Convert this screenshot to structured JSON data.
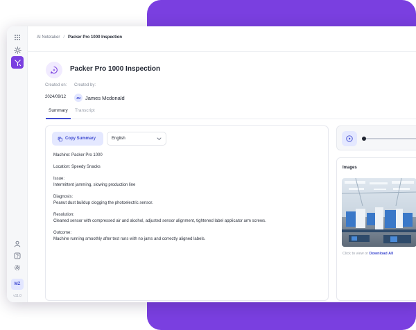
{
  "breadcrumb": {
    "root": "AI Notetaker",
    "separator": "/",
    "current": "Packer Pro 1000 Inspection"
  },
  "page": {
    "title": "Packer Pro 1000 Inspection",
    "title_icon": "sparkle-chat-icon"
  },
  "meta": {
    "created_on_label": "Created on:",
    "created_by_label": "Created by:",
    "created_on": "2024/09/12",
    "creator_initials": "JM",
    "creator_name": "James Mcdonald"
  },
  "tabs": [
    {
      "label": "Summary",
      "active": true
    },
    {
      "label": "Transcript",
      "active": false
    }
  ],
  "toolbar": {
    "copy_label": "Copy Summary",
    "language": "English"
  },
  "summary": {
    "machine": "Machine: Packer Pro 1000",
    "location": "Location: Speedy Snacks",
    "issue_label": "Issue:",
    "issue": "Intermittent jamming, slowing production line",
    "diagnosis_label": "Diagnosis:",
    "diagnosis": "Peanut dust buildup clogging the photoelectric sensor.",
    "resolution_label": "Resolution:",
    "resolution": "Cleaned sensor with compressed air and alcohol, adjusted sensor alignment, tightened label applicator arm screws.",
    "outcome_label": "Outcome:",
    "outcome": "Machine running smoothly after test runs with no jams and correctly aligned labels."
  },
  "player": {
    "progress_fraction": 0.02
  },
  "images": {
    "title": "Images",
    "caption_prefix": "Click to view or",
    "download_label": "Download All"
  },
  "sidebar": {
    "items": [
      {
        "icon": "grid-icon",
        "active": false
      },
      {
        "icon": "settings-icon",
        "active": false
      },
      {
        "icon": "workflow-icon",
        "active": true
      }
    ],
    "bottom_items": [
      {
        "icon": "user-icon"
      },
      {
        "icon": "help-icon"
      },
      {
        "icon": "gear-icon"
      }
    ],
    "user_initials": "MZ",
    "version": "v11.0"
  },
  "colors": {
    "accent": "#7a3fe0",
    "primary": "#3f4bd0",
    "primary_soft": "#e4e8ff"
  }
}
